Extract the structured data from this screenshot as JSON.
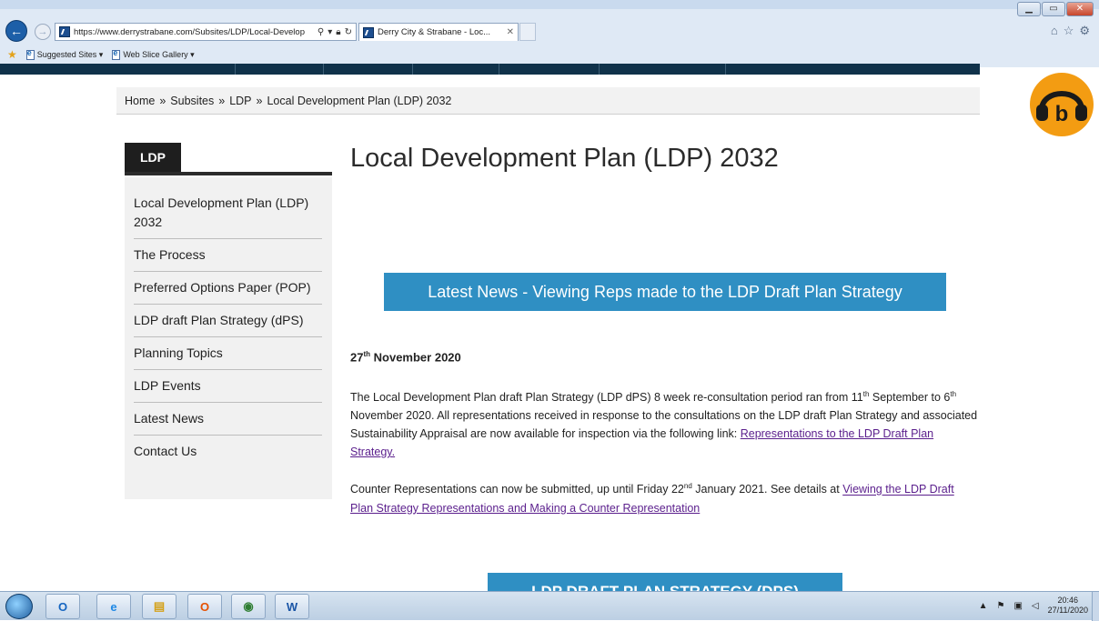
{
  "browser": {
    "url": "https://www.derrystrabane.com/Subsites/LDP/Local-Develop",
    "tab_title": "Derry City & Strabane - Loc...",
    "favorites": [
      "Suggested Sites ▾",
      "Web Slice Gallery ▾"
    ]
  },
  "breadcrumb": {
    "items": [
      "Home",
      "Subsites",
      "LDP",
      "Local Development Plan (LDP) 2032"
    ],
    "separator": "»"
  },
  "sidebar": {
    "heading": "LDP",
    "items": [
      {
        "label": "Local Development Plan (LDP) 2032"
      },
      {
        "label": "The Process"
      },
      {
        "label": "Preferred Options Paper (POP)"
      },
      {
        "label": "LDP draft Plan Strategy (dPS)"
      },
      {
        "label": "Planning Topics"
      },
      {
        "label": "LDP Events"
      },
      {
        "label": "Latest News"
      },
      {
        "label": "Contact Us"
      }
    ]
  },
  "main": {
    "title": "Local Development Plan (LDP) 2032",
    "news_button": "Latest News - Viewing Reps made to the LDP Draft Plan Strategy",
    "date": {
      "day": "27",
      "suffix": "th",
      "rest": " November 2020"
    },
    "para1": {
      "p1": "The Local Development Plan draft Plan Strategy (LDP dPS) 8 week re-consultation period ran from 11",
      "s1": "th",
      "p2": " September to 6",
      "s2": "th",
      "p3": " November 2020. All representations received in response to the consultations on the LDP draft Plan Strategy and associated Sustainability Appraisal are now available for inspection via the following link: ",
      "link": "Representations to the LDP  Draft Plan Strategy."
    },
    "para2": {
      "p1": "Counter Representations can now be submitted, up until Friday 22",
      "s1": "nd",
      "p2": " January 2021. See details at ",
      "link": "Viewing the LDP Draft Plan Strategy Representations and Making a Counter Representation"
    },
    "dps_button": "LDP DRAFT PLAN STRATEGY (DPS)"
  },
  "taskbar": {
    "apps": [
      "outlook",
      "internet-explorer",
      "file-explorer",
      "office",
      "chrome",
      "word"
    ],
    "time": "20:46",
    "date": "27/11/2020"
  },
  "colors": {
    "accent_blue": "#2f8fc3",
    "site_bar": "#10324a",
    "visited_link": "#5a1e8c",
    "readaloud_orange": "#f39c12"
  }
}
